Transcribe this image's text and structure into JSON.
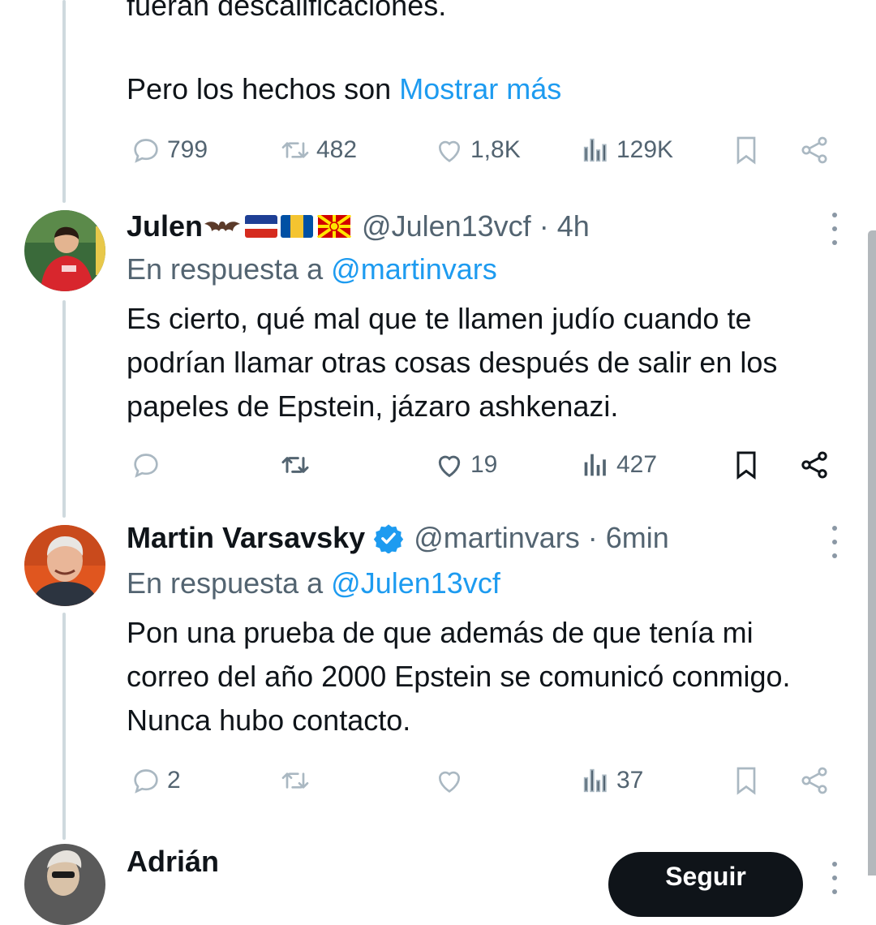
{
  "tweet_top": {
    "text_partial": "fueran descalificaciones.",
    "text_line2": "Pero los hechos son ",
    "show_more": "Mostrar más",
    "actions": {
      "replies": "799",
      "retweets": "482",
      "likes": "1,8K",
      "views": "129K"
    }
  },
  "reply1": {
    "name": "Julen",
    "emoji_flags": [
      "bat-emoji",
      "flag-icon",
      "flag-icon",
      "north-macedonia-flag-icon"
    ],
    "handle": "@Julen13vcf",
    "time": "4h",
    "reply_prefix": "En respuesta a ",
    "reply_to": "@martinvars",
    "text": "Es cierto, qué mal que te llamen judío cuando te podrían llamar otras cosas después de salir en los papeles de Epstein, jázaro ashkenazi.",
    "actions": {
      "replies": "",
      "retweets": "",
      "likes": "19",
      "views": "427"
    }
  },
  "reply2": {
    "name": "Martin Varsavsky",
    "verified": true,
    "handle": "@martinvars",
    "time": "6min",
    "reply_prefix": "En respuesta a ",
    "reply_to": "@Julen13vcf",
    "text": "Pon una prueba de que además de que tenía mi correo del año 2000 Epstein se comunicó conmigo. Nunca hubo contacto.",
    "actions": {
      "replies": "2",
      "retweets": "",
      "likes": "",
      "views": "37"
    }
  },
  "reply3": {
    "name": "Adrián",
    "follow_label": "Seguir"
  },
  "colors": {
    "link": "#1d9bf0",
    "verified": "#1d9bf0",
    "muted": "#536471",
    "faded": "#aab8c2"
  }
}
